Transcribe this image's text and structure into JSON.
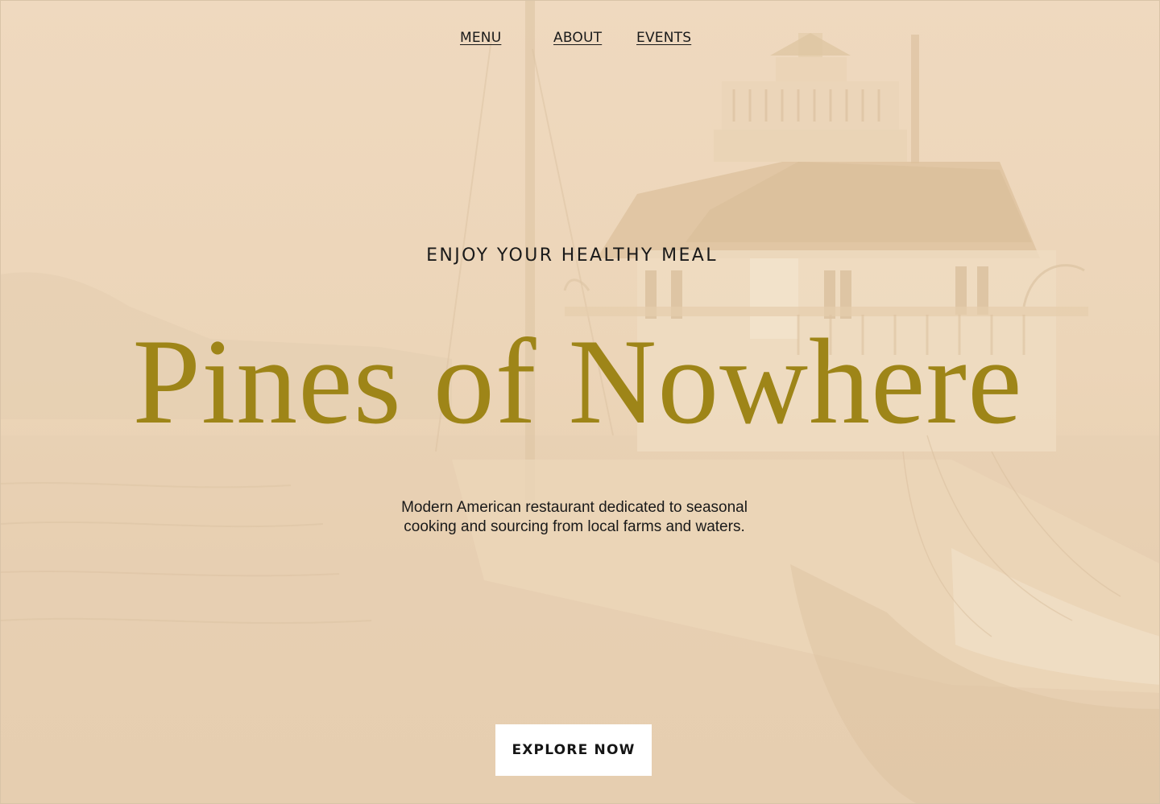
{
  "nav": {
    "items": [
      {
        "label": "MENU"
      },
      {
        "label": "ABOUT"
      },
      {
        "label": "EVENTS"
      }
    ]
  },
  "hero": {
    "eyebrow": "ENJOY YOUR HEALTHY MEAL",
    "title": "Pines of Nowhere",
    "subtitle_line1": "Modern American restaurant dedicated to seasonal",
    "subtitle_line2": "cooking and sourcing from local farms and waters.",
    "cta_label": "EXPLORE NOW"
  },
  "colors": {
    "background_tint": "#ecd6bb",
    "title": "#9e8518",
    "text": "#1a1a1a",
    "cta_background": "#ffffff"
  }
}
